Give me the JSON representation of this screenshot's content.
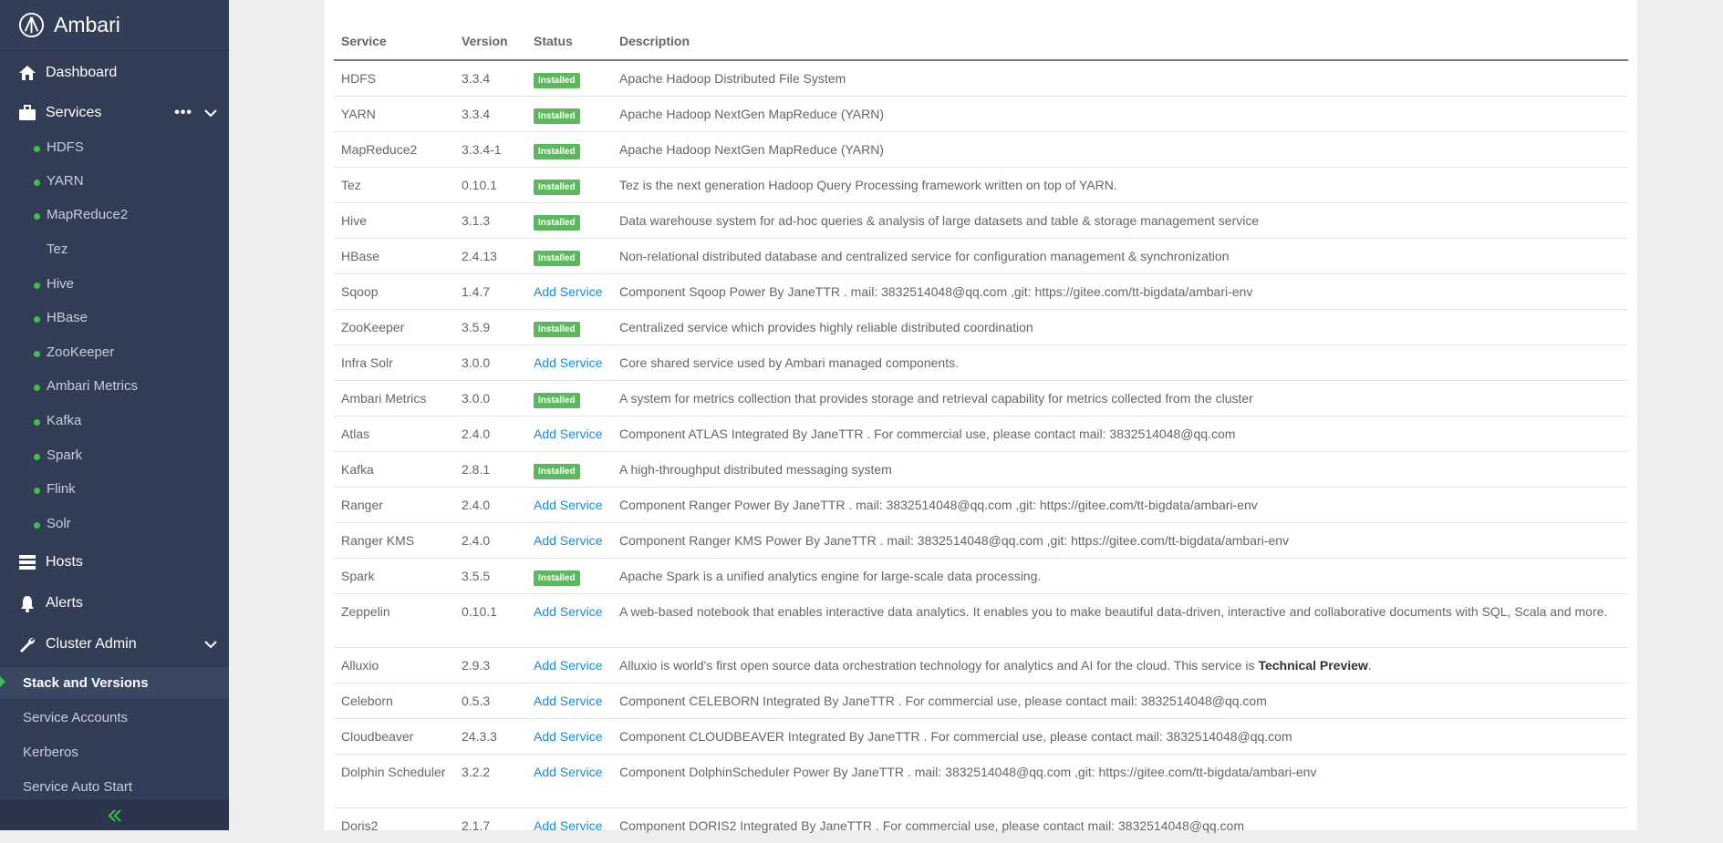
{
  "app": {
    "title": "Ambari"
  },
  "sidebar": {
    "dashboard": "Dashboard",
    "services": "Services",
    "services_more": "•••",
    "service_items": [
      {
        "label": "HDFS",
        "status": "green"
      },
      {
        "label": "YARN",
        "status": "green"
      },
      {
        "label": "MapReduce2",
        "status": "green"
      },
      {
        "label": "Tez",
        "status": "none"
      },
      {
        "label": "Hive",
        "status": "green"
      },
      {
        "label": "HBase",
        "status": "green"
      },
      {
        "label": "ZooKeeper",
        "status": "green"
      },
      {
        "label": "Ambari Metrics",
        "status": "green"
      },
      {
        "label": "Kafka",
        "status": "green"
      },
      {
        "label": "Spark",
        "status": "green"
      },
      {
        "label": "Flink",
        "status": "green"
      },
      {
        "label": "Solr",
        "status": "green"
      }
    ],
    "hosts": "Hosts",
    "alerts": "Alerts",
    "cluster_admin": "Cluster Admin",
    "cluster_admin_items": [
      {
        "label": "Stack and Versions",
        "active": true
      },
      {
        "label": "Service Accounts",
        "active": false
      },
      {
        "label": "Kerberos",
        "active": false
      },
      {
        "label": "Service Auto Start",
        "active": false
      }
    ],
    "collapse_icon": "double-chevron-left-icon"
  },
  "table": {
    "headers": {
      "service": "Service",
      "version": "Version",
      "status": "Status",
      "description": "Description"
    },
    "rows": [
      {
        "service": "HDFS",
        "version": "3.3.4",
        "status": "Installed",
        "description": "Apache Hadoop Distributed File System"
      },
      {
        "service": "YARN",
        "version": "3.3.4",
        "status": "Installed",
        "description": "Apache Hadoop NextGen MapReduce (YARN)"
      },
      {
        "service": "MapReduce2",
        "version": "3.3.4-1",
        "status": "Installed",
        "description": "Apache Hadoop NextGen MapReduce (YARN)"
      },
      {
        "service": "Tez",
        "version": "0.10.1",
        "status": "Installed",
        "description": "Tez is the next generation Hadoop Query Processing framework written on top of YARN."
      },
      {
        "service": "Hive",
        "version": "3.1.3",
        "status": "Installed",
        "description": "Data warehouse system for ad-hoc queries & analysis of large datasets and table & storage management service"
      },
      {
        "service": "HBase",
        "version": "2.4.13",
        "status": "Installed",
        "description": "Non-relational distributed database and centralized service for configuration management & synchronization"
      },
      {
        "service": "Sqoop",
        "version": "1.4.7",
        "status": "Add Service",
        "description": "Component Sqoop Power By JaneTTR . mail: 3832514048@qq.com ,git: https://gitee.com/tt-bigdata/ambari-env"
      },
      {
        "service": "ZooKeeper",
        "version": "3.5.9",
        "status": "Installed",
        "description": "Centralized service which provides highly reliable distributed coordination"
      },
      {
        "service": "Infra Solr",
        "version": "3.0.0",
        "status": "Add Service",
        "description": "Core shared service used by Ambari managed components."
      },
      {
        "service": "Ambari Metrics",
        "version": "3.0.0",
        "status": "Installed",
        "description": "A system for metrics collection that provides storage and retrieval capability for metrics collected from the cluster"
      },
      {
        "service": "Atlas",
        "version": "2.4.0",
        "status": "Add Service",
        "description": "Component ATLAS Integrated By JaneTTR . For commercial use, please contact mail: 3832514048@qq.com"
      },
      {
        "service": "Kafka",
        "version": "2.8.1",
        "status": "Installed",
        "description": "A high-throughput distributed messaging system"
      },
      {
        "service": "Ranger",
        "version": "2.4.0",
        "status": "Add Service",
        "description": "Component Ranger Power By JaneTTR . mail: 3832514048@qq.com ,git: https://gitee.com/tt-bigdata/ambari-env"
      },
      {
        "service": "Ranger KMS",
        "version": "2.4.0",
        "status": "Add Service",
        "description": "Component Ranger KMS Power By JaneTTR . mail: 3832514048@qq.com ,git: https://gitee.com/tt-bigdata/ambari-env"
      },
      {
        "service": "Spark",
        "version": "3.5.5",
        "status": "Installed",
        "description": "Apache Spark is a unified analytics engine for large-scale data processing."
      },
      {
        "service": "Zeppelin",
        "version": "0.10.1",
        "status": "Add Service",
        "description": "A web-based notebook that enables interactive data analytics. It enables you to make beautiful data-driven, interactive and collaborative documents with SQL, Scala and more."
      },
      {
        "service": "Alluxio",
        "version": "2.9.3",
        "status": "Add Service",
        "description": "Alluxio is world's first open source data orchestration technology for analytics and AI for the cloud. This service is ",
        "description_bold": "Technical Preview",
        "description_tail": "."
      },
      {
        "service": "Celeborn",
        "version": "0.5.3",
        "status": "Add Service",
        "description": "Component CELEBORN Integrated By JaneTTR . For commercial use, please contact mail: 3832514048@qq.com"
      },
      {
        "service": "Cloudbeaver",
        "version": "24.3.3",
        "status": "Add Service",
        "description": "Component CLOUDBEAVER Integrated By JaneTTR . For commercial use, please contact mail: 3832514048@qq.com"
      },
      {
        "service": "Dolphin Scheduler",
        "version": "3.2.2",
        "status": "Add Service",
        "description": "Component DolphinScheduler Power By JaneTTR . mail: 3832514048@qq.com ,git: https://gitee.com/tt-bigdata/ambari-env"
      },
      {
        "service": "Doris2",
        "version": "2.1.7",
        "status": "Add Service",
        "description": "Component DORIS2 Integrated By JaneTTR . For commercial use, please contact mail: 3832514048@qq.com"
      }
    ]
  },
  "colors": {
    "sidebar_bg": "#313d54",
    "installed_badge": "#5cb85c",
    "link": "#1a8ad4",
    "status_dot": "#3fbf4f"
  }
}
